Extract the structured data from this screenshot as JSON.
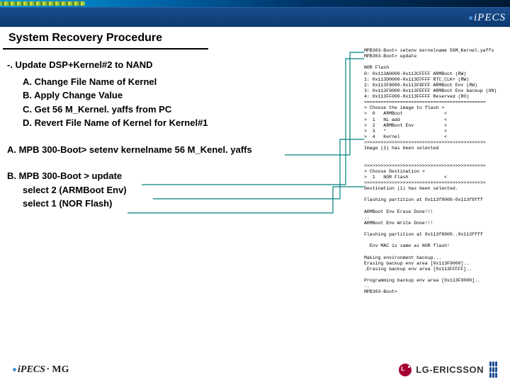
{
  "header": {
    "brand": "iPECS",
    "title": "System Recovery Procedure"
  },
  "content": {
    "step_head": "-. Update DSP+Kernel#2 to NAND",
    "sub_a": "A. Change File Name of Kernel",
    "sub_b": "B. Apply Change Value",
    "sub_c": "C. Get 56 M_Kernel. yaffs from PC",
    "sub_d": "D. Revert File Name of Kernel for Kernel#1",
    "cmd_a": "A. MPB 300-Boot> setenv kernelname 56 M_Kenel. yaffs",
    "cmd_b_head": "B. MPB 300-Boot > update",
    "cmd_b_sel2": "select 2 (ARMBoot Env)",
    "cmd_b_sel1": "select 1 (NOR Flash)"
  },
  "terminal": "MPB303-Boot> setenv kernelname 56M_Kernel.yaffs\nMPB303-Boot> update\n\nNOR Flash\n0: 0x113A0000-0x113CFFFF ARMBoot (RW)\n1: 0x113D0000-0x113D7FFF RTC_CLK+ (RW)\n2: 0x113F8000-0x113F8FFF ARMBoot Env (RW)\n3: 0x113F9000-0x113FEFFF ARMBoot Env backup (ON)\n4: 0x113FF000-0x113FFFFF Reserved (RO)\n============================================\n> Choose the image to flash >\n>  0   ARMBoot               <\n>  1   NL add                <\n>  2   ARMBoot Env           <\n>  3   *                     <\n>  4   Kernel                <\n>>>>>>>>>>>>>>>>>>>>>>>>>>>>>>>>>>>>>>>>>>>>\nImage (2) has been selected\n\n\n>>>>>>>>>>>>>>>>>>>>>>>>>>>>>>>>>>>>>>>>>>>>\n> Choose Destination >\n>  1   NOR Flash             <\n>>>>>>>>>>>>>>>>>>>>>>>>>>>>>>>>>>>>>>>>>>>>\nDestination (1) has been selected.\n\nFlashing partition at 0x113f8000-0x113f8fff\n\nARMBoot Env Erase Done!!!\n..\nARMBoot Env Write Done!!!\n\nFlashing partition at 0x113f8000..0x113ffff\n\n  Env MAC is same as NOR flash!\n\nMaking environment backup...\nErasing backup env area [0x113F9000]..\n.Erasing backup env area [0x113FFFFF]..\n\nProgramming backup env area [0x113F9000]..\n..\nMPB303-Boot>",
  "footer": {
    "brand_left_1": "iPECS",
    "brand_left_2": "MG",
    "brand_right": "LG-ERICSSON"
  }
}
